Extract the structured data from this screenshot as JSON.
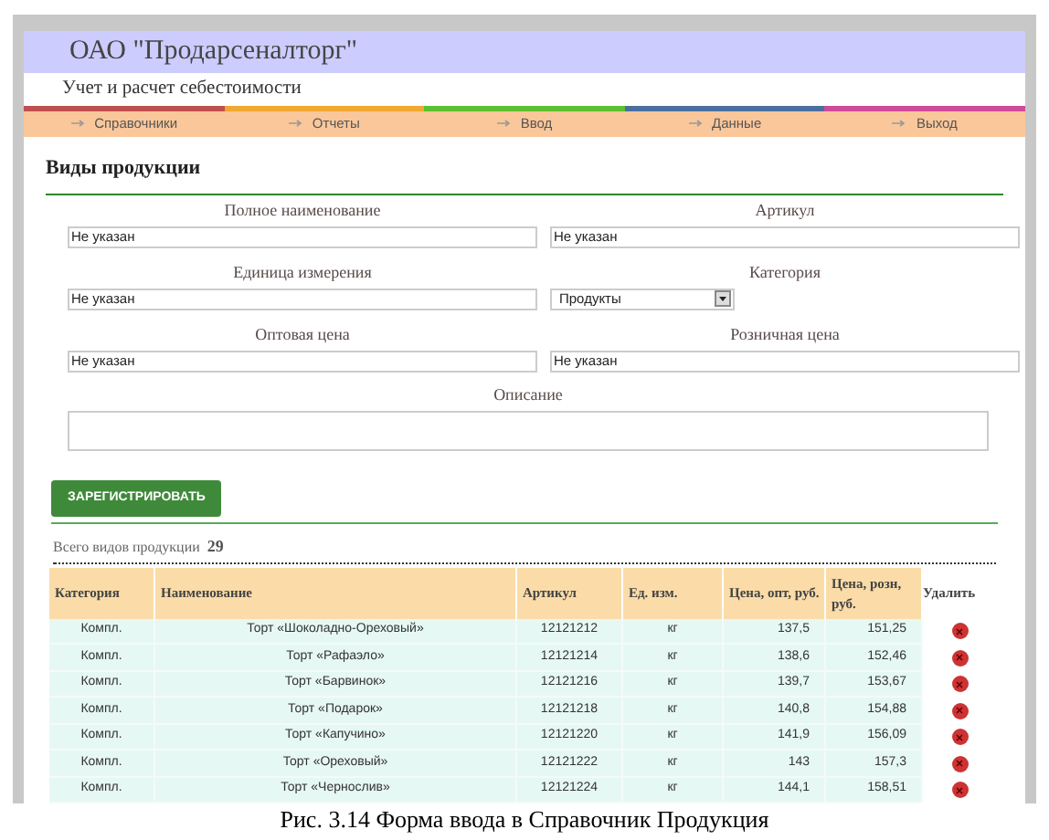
{
  "header": {
    "title": "ОАО \"Продарсеналторг\"",
    "subtitle": "Учет и расчет себестоимости"
  },
  "nav": [
    {
      "label": "Справочники",
      "color": "#c0504d"
    },
    {
      "label": "Отчеты",
      "color": "#f0a830"
    },
    {
      "label": "Ввод",
      "color": "#5cc030"
    },
    {
      "label": "Данные",
      "color": "#4a6fa0"
    },
    {
      "label": "Выход",
      "color": "#d04a9a"
    }
  ],
  "section_title": "Виды продукции",
  "form": {
    "fields": [
      {
        "kind": "text",
        "label": "Полное наименование",
        "value": "Не указан"
      },
      {
        "kind": "text",
        "label": "Артикул",
        "value": "Не указан"
      },
      {
        "kind": "text",
        "label": "Единица измерения",
        "value": "Не указан"
      },
      {
        "kind": "select",
        "label": "Категория",
        "value": "Продукты"
      },
      {
        "kind": "text",
        "label": "Оптовая цена",
        "value": "Не указан"
      },
      {
        "kind": "text",
        "label": "Розничная цена",
        "value": "Не указан"
      }
    ],
    "description_label": "Описание",
    "submit": "ЗАРЕГИСТРИРОВАТЬ"
  },
  "total": {
    "label": "Всего видов продукции",
    "count": "29"
  },
  "table": {
    "columns": [
      "Категория",
      "Наименование",
      "Артикул",
      "Ед. изм.",
      "Цена, опт, руб.",
      "Цена, розн, руб.",
      "Удалить"
    ],
    "rows": [
      [
        "Компл.",
        "Торт «Шоколадно-Ореховый»",
        "12121212",
        "кг",
        "137,5",
        "151,25"
      ],
      [
        "Компл.",
        "Торт «Рафаэло»",
        "12121214",
        "кг",
        "138,6",
        "152,46"
      ],
      [
        "Компл.",
        "Торт «Барвинок»",
        "12121216",
        "кг",
        "139,7",
        "153,67"
      ],
      [
        "Компл.",
        "Торт «Подарок»",
        "12121218",
        "кг",
        "140,8",
        "154,88"
      ],
      [
        "Компл.",
        "Торт «Капучино»",
        "12121220",
        "кг",
        "141,9",
        "156,09"
      ],
      [
        "Компл.",
        "Торт «Ореховый»",
        "12121222",
        "кг",
        "143",
        "157,3"
      ],
      [
        "Компл.",
        "Торт «Чернослив»",
        "12121224",
        "кг",
        "144,1",
        "158,51"
      ]
    ]
  },
  "caption": "Рис. 3.14 Форма ввода в Справочник Продукция"
}
